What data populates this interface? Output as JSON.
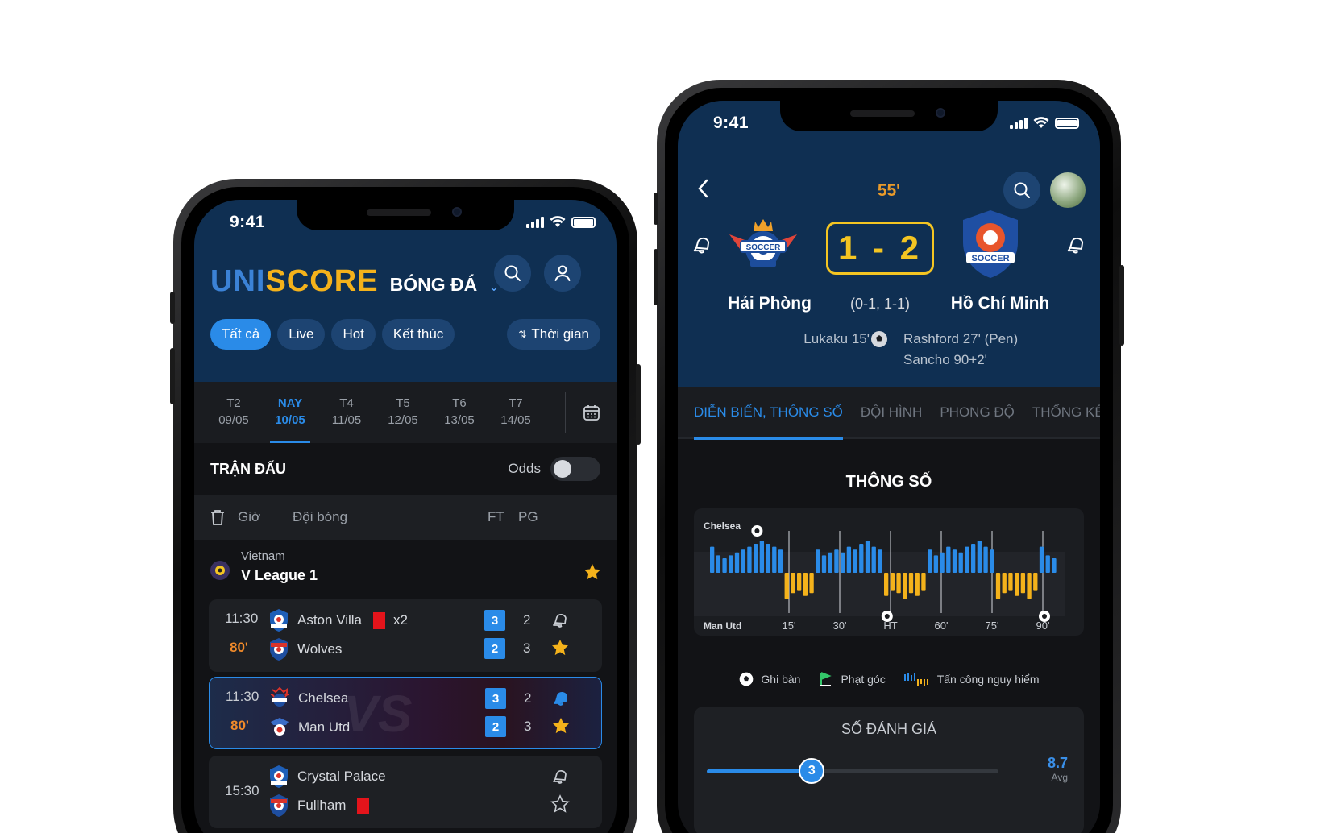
{
  "left_phone": {
    "status_time": "9:41",
    "brand": {
      "part1": "UNI",
      "part2": "SCORE",
      "sport": "BÓNG ĐÁ"
    },
    "filters": [
      "Tất cả",
      "Live",
      "Hot",
      "Kết thúc"
    ],
    "filter_time": "Thời gian",
    "dates": [
      {
        "day": "T2",
        "date": "09/05"
      },
      {
        "day": "NAY",
        "date": "10/05"
      },
      {
        "day": "T4",
        "date": "11/05"
      },
      {
        "day": "T5",
        "date": "12/05"
      },
      {
        "day": "T6",
        "date": "13/05"
      },
      {
        "day": "T7",
        "date": "14/05"
      }
    ],
    "section_title": "TRẬN ĐẤU",
    "odds_label": "Odds",
    "columns": {
      "time": "Giờ",
      "team": "Đội bóng",
      "ft": "FT",
      "pg": "PG"
    },
    "league": {
      "country": "Vietnam",
      "name": "V League 1"
    },
    "matches": [
      {
        "time": "11:30",
        "minute": "80'",
        "home": "Aston Villa",
        "home_cards": "x2",
        "away": "Wolves",
        "home_ft": "3",
        "away_ft": "2",
        "home_pg": "2",
        "away_pg": "3"
      },
      {
        "time": "11:30",
        "minute": "80'",
        "home": "Chelsea",
        "away": "Man Utd",
        "home_ft": "3",
        "away_ft": "2",
        "home_pg": "2",
        "away_pg": "3"
      },
      {
        "time": "15:30",
        "home": "Crystal Palace",
        "away": "Fullham"
      }
    ]
  },
  "right_phone": {
    "status_time": "9:41",
    "minute": "55'",
    "score": "1 - 2",
    "home_team": "Hải Phòng",
    "away_team": "Hồ Chí Minh",
    "halftime": "(0-1, 1-1)",
    "home_scorers": "Lukaku 15'",
    "away_scorers": [
      "Rashford 27' (Pen)",
      "Sancho 90+2'"
    ],
    "tabs": [
      "DIỄN BIẾN, THÔNG SỐ",
      "ĐỘI HÌNH",
      "PHONG ĐỘ",
      "THỐNG KÊ"
    ],
    "stats_title": "THÔNG SỐ",
    "chart_data": {
      "type": "bar",
      "title": "",
      "top_team": "Chelsea",
      "bottom_team": "Man Utd",
      "x_ticks": [
        "15'",
        "30'",
        "HT",
        "60'",
        "75'",
        "90'"
      ],
      "series": [
        {
          "name": "Chelsea",
          "color": "#2a8be8",
          "values": [
            9,
            6,
            5,
            6,
            7,
            8,
            9,
            10,
            11,
            10,
            9,
            8,
            0,
            0,
            0,
            0,
            0,
            8,
            6,
            7,
            8,
            7,
            9,
            8,
            10,
            11,
            9,
            8,
            0,
            0,
            0,
            0,
            0,
            0,
            0,
            8,
            6,
            7,
            9,
            8,
            7,
            9,
            10,
            11,
            9,
            8,
            0,
            0,
            0,
            0,
            0,
            0,
            0,
            9,
            6,
            5
          ]
        },
        {
          "name": "Man Utd",
          "color": "#f4b21b",
          "values": [
            0,
            0,
            0,
            0,
            0,
            0,
            0,
            0,
            0,
            0,
            0,
            0,
            9,
            7,
            6,
            8,
            7,
            0,
            0,
            0,
            0,
            0,
            0,
            0,
            0,
            0,
            0,
            0,
            8,
            6,
            7,
            9,
            7,
            8,
            6,
            0,
            0,
            0,
            0,
            0,
            0,
            0,
            0,
            0,
            0,
            0,
            9,
            7,
            6,
            8,
            7,
            9,
            6,
            0,
            0,
            0
          ]
        }
      ],
      "goals_top_minutes": [
        7
      ],
      "goals_bottom_minutes": [
        44,
        90
      ],
      "legend": [
        "Ghi bàn",
        "Phạt góc",
        "Tấn công nguy hiểm"
      ]
    },
    "rating": {
      "title": "SỐ ĐÁNH GIÁ",
      "value": "3",
      "fraction": 0.36,
      "score": "8.7",
      "score_label": "Avg"
    }
  }
}
